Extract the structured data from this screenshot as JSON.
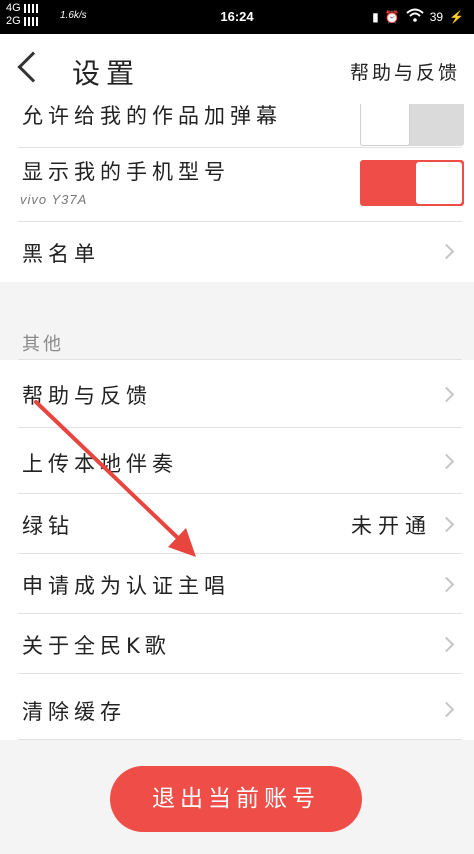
{
  "status_bar": {
    "network_1": "4G",
    "network_2": "2G",
    "speed": "1.6k/s",
    "time": "16:24",
    "battery": "39"
  },
  "header": {
    "title": "设置",
    "help_link": "帮助与反馈"
  },
  "rows": {
    "allow_danmaku": {
      "label": "允许给我的作品加弹幕",
      "enabled": false
    },
    "show_phone_model": {
      "label": "显示我的手机型号",
      "sub": "vivo Y37A",
      "enabled": true
    },
    "blacklist": {
      "label": "黑名单"
    }
  },
  "section_other": {
    "title": "其他",
    "items": [
      {
        "label": "帮助与反馈"
      },
      {
        "label": "上传本地伴奏"
      },
      {
        "label": "绿钻",
        "value": "未开通"
      },
      {
        "label": "申请成为认证主唱"
      },
      {
        "label": "关于全民K歌"
      },
      {
        "label": "清除缓存"
      }
    ]
  },
  "logout_button": "退出当前账号",
  "colors": {
    "accent": "#ef4d48",
    "toggle_off": "#dadada"
  }
}
